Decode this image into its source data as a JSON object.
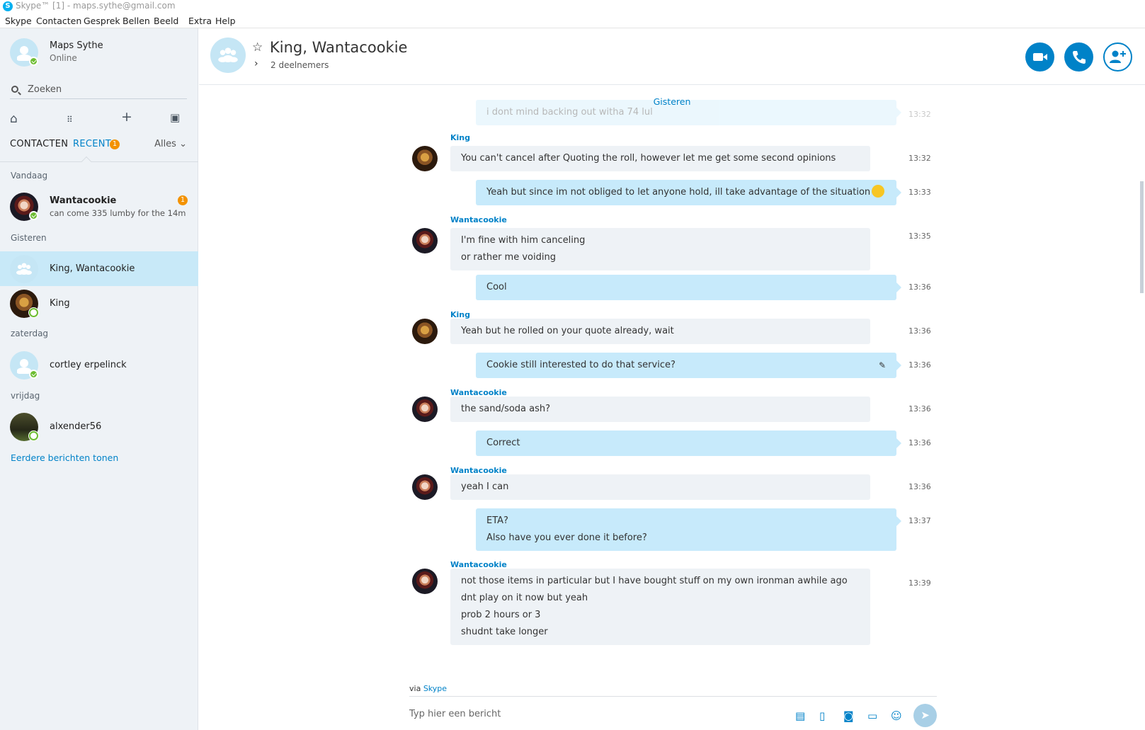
{
  "window": {
    "title": "Skype™ [1] - maps.sythe@gmail.com"
  },
  "menu": [
    "Skype",
    "Contacten",
    "Gesprek",
    "Bellen",
    "Beeld",
    "Extra",
    "Help"
  ],
  "me": {
    "name": "Maps Sythe",
    "status": "Online"
  },
  "search": {
    "label": "Zoeken"
  },
  "tabs": {
    "contacts": "CONTACTEN",
    "recent": "RECENT",
    "recent_badge": "1",
    "filter": "Alles"
  },
  "sections": {
    "today": "Vandaag",
    "yesterday": "Gisteren",
    "saturday": "zaterdag",
    "friday": "vrijdag"
  },
  "recent": [
    {
      "name": "Wantacookie",
      "preview": "can come 335 lumby for the 14m",
      "badge": "1"
    },
    {
      "name": "King, Wantacookie"
    },
    {
      "name": "King"
    },
    {
      "name": "cortley erpelinck"
    },
    {
      "name": "alxender56"
    }
  ],
  "more_link": "Eerdere berichten tonen",
  "conversation": {
    "title": "King, Wantacookie",
    "participants": "2 deelnemers"
  },
  "messages": {
    "date_label": "Gisteren",
    "faded_text": "i dont mind backing out witha 74 lul",
    "faded_time": "13:32",
    "items": [
      {
        "sender": "King",
        "lines": [
          "You can't cancel after Quoting the roll, however let me get some second opinions"
        ],
        "time": "13:32"
      },
      {
        "lines": [
          "Yeah but since im not obliged to let anyone hold, ill take advantage of the situation"
        ],
        "time": "13:33"
      },
      {
        "sender": "Wantacookie",
        "lines": [
          "I'm fine with him canceling",
          "or rather me voiding"
        ],
        "time": "13:35"
      },
      {
        "lines": [
          "Cool"
        ],
        "time": "13:36"
      },
      {
        "sender": "King",
        "lines": [
          "Yeah but he rolled on your quote already, wait"
        ],
        "time": "13:36"
      },
      {
        "lines": [
          "Cookie still interested to do that service?"
        ],
        "time": "13:36"
      },
      {
        "sender": "Wantacookie",
        "lines": [
          "the sand/soda ash?"
        ],
        "time": "13:36"
      },
      {
        "lines": [
          "Correct"
        ],
        "time": "13:36"
      },
      {
        "sender": "Wantacookie",
        "lines": [
          "yeah I can"
        ],
        "time": "13:36"
      },
      {
        "lines": [
          "ETA?",
          "Also have you ever done it before?"
        ],
        "time": "13:37"
      },
      {
        "sender": "Wantacookie",
        "lines": [
          "not those items in particular but I have bought stuff on my own ironman awhile ago",
          "dnt play on it now but yeah",
          "prob 2 hours or 3",
          "shudnt take longer"
        ],
        "time": "13:39"
      }
    ]
  },
  "composer": {
    "via": "via",
    "via_link": "Skype",
    "placeholder": "Typ hier een bericht"
  },
  "colors": {
    "accent": "#0082c8",
    "badge": "#f39200",
    "online": "#6dbd31",
    "outgoing_bubble": "#c7eafb",
    "incoming_bubble": "#eef2f6"
  }
}
